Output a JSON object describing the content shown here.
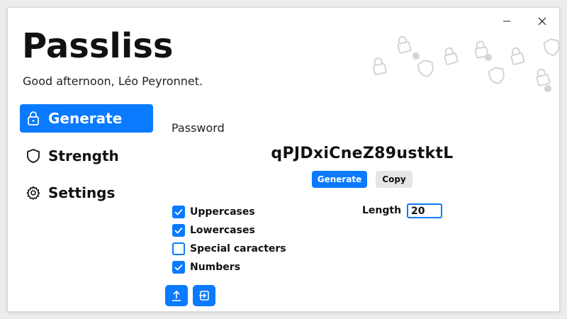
{
  "window": {
    "minimize_glyph": "—",
    "close_glyph": "✕"
  },
  "app": {
    "title": "Passliss",
    "greeting": "Good afternoon, Léo Peyronnet."
  },
  "nav": {
    "items": [
      {
        "label": "Generate",
        "icon": "lock-icon",
        "active": true
      },
      {
        "label": "Strength",
        "icon": "shield-icon",
        "active": false
      },
      {
        "label": "Settings",
        "icon": "gear-icon",
        "active": false
      }
    ]
  },
  "generator": {
    "password_label": "Password",
    "password_value": "qPJDxiCneZ89ustktL",
    "generate_label": "Generate",
    "copy_label": "Copy",
    "options": [
      {
        "label": "Uppercases",
        "checked": true
      },
      {
        "label": "Lowercases",
        "checked": true
      },
      {
        "label": "Special caracters",
        "checked": false
      },
      {
        "label": "Numbers",
        "checked": true
      }
    ],
    "length_label": "Length",
    "length_value": "20",
    "actions": [
      {
        "icon": "upload-icon"
      },
      {
        "icon": "export-icon"
      }
    ]
  },
  "colors": {
    "accent": "#0a7aff",
    "secondary_button": "#e6e6e6",
    "decor": "#d4d4d4"
  }
}
